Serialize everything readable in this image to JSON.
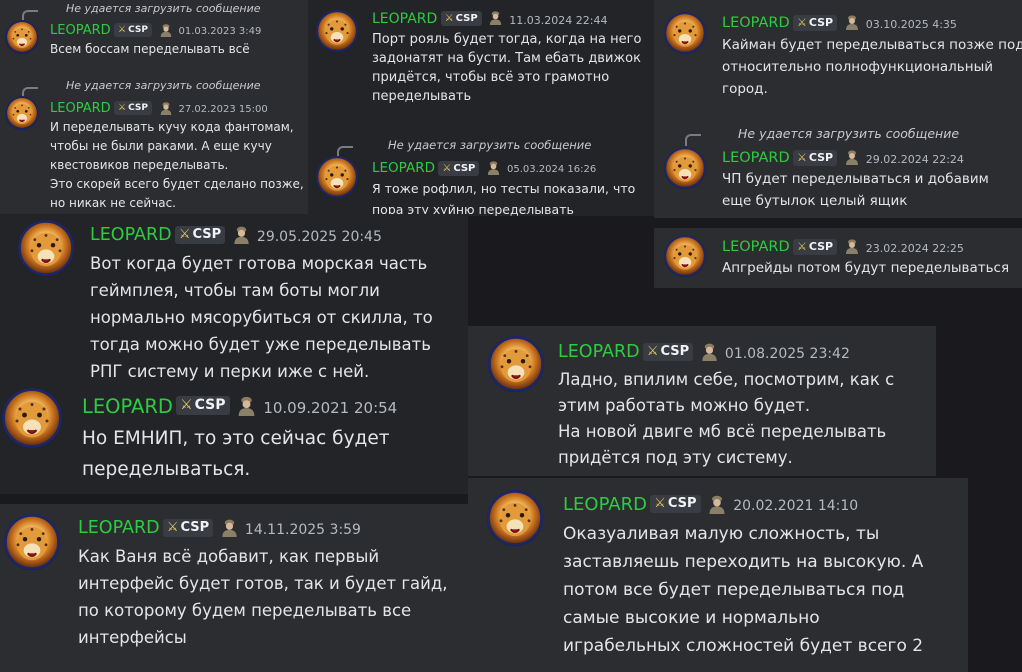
{
  "colors": {
    "background": "#1a1a1e",
    "card": "#2b2d31",
    "username": "#2ecc40",
    "text": "#e3e5e8",
    "timestamp": "#b5bac1"
  },
  "reply_text": "Не удается загрузить сообщение",
  "messages": [
    {
      "user": "LEOPARD",
      "tag": "CSP",
      "time": "01.03.2023 3:49",
      "text": [
        "Всем боссам переделывать всё"
      ]
    },
    {
      "user": "LEOPARD",
      "tag": "CSP",
      "time": "11.03.2024 22:44",
      "text": [
        "Порт рояль будет тогда, когда на него",
        "задонатят на бусти. Там ебать движок",
        "придётся, чтобы всё это грамотно",
        "переделывать"
      ]
    },
    {
      "user": "LEOPARD",
      "tag": "CSP",
      "time": "03.10.2025 4:35",
      "text": [
        "Кайман будет переделываться позже под",
        "относительно полнофункциональный",
        "город."
      ]
    },
    {
      "user": "LEOPARD",
      "tag": "CSP",
      "time": "27.02.2023 15:00",
      "text": [
        "И переделывать кучу кода фантомам,",
        "чтобы не были раками. А еще кучу",
        "квестовиков переделывать.",
        "Это скорей всего будет сделано позже,",
        "но никак не сейчас."
      ]
    },
    {
      "user": "LEOPARD",
      "tag": "CSP",
      "time": "05.03.2024 16:26",
      "text": [
        "Я тоже рофлил, но тесты показали, что",
        "пора эту хуйню переделывать"
      ]
    },
    {
      "user": "LEOPARD",
      "tag": "CSP",
      "time": "29.02.2024 22:24",
      "text": [
        "ЧП будет переделываться и добавим",
        "еще бутылок целый ящик"
      ]
    },
    {
      "user": "LEOPARD",
      "tag": "CSP",
      "time": "23.02.2024 22:25",
      "text": [
        "Апгрейды потом будут переделываться"
      ]
    },
    {
      "user": "LEOPARD",
      "tag": "CSP",
      "time": "29.05.2025 20:45",
      "text": [
        "Вот когда будет готова морская часть",
        "геймплея, чтобы там боты могли",
        "нормально мясорубиться от скилла, то",
        "тогда можно будет уже переделывать",
        "РПГ систему и перки иже с ней."
      ]
    },
    {
      "user": "LEOPARD",
      "tag": "CSP",
      "time": "01.08.2025 23:42",
      "text": [
        "Ладно, впилим себе, посмотрим, как с",
        "этим работать можно будет.",
        "На новой двиге мб всё переделывать",
        "придётся под эту систему."
      ]
    },
    {
      "user": "LEOPARD",
      "tag": "CSP",
      "time": "10.09.2021 20:54",
      "text": [
        "Но ЕМНИП, то это сейчас будет",
        "переделываться."
      ]
    },
    {
      "user": "LEOPARD",
      "tag": "CSP",
      "time": "14.11.2025 3:59",
      "text": [
        "Как Ваня всё добавит, как первый",
        "интерфейс будет готов, так и будет гайд,",
        "по которому будем переделывать все",
        "интерфейсы"
      ]
    },
    {
      "user": "LEOPARD",
      "tag": "CSP",
      "time": "20.02.2021 14:10",
      "text": [
        "Оказуаливая малую сложность, ты",
        "заставляешь переходить на высокую. А",
        "потом все будет переделываться под",
        "самые высокие и нормально",
        "играбельных сложностей будет всего 2"
      ]
    }
  ]
}
